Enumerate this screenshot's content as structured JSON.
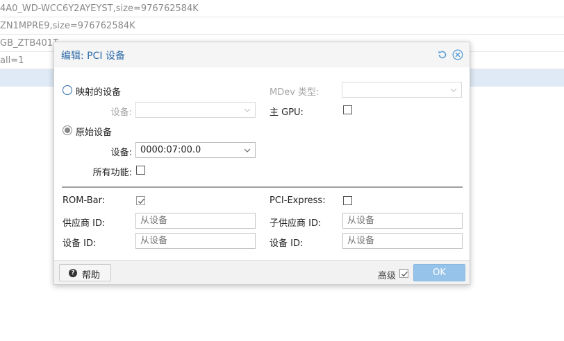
{
  "background_rows": [
    {
      "text": "4A0_WD-WCC6Y2AYEYST,size=976762584K"
    },
    {
      "text": "ZN1MPRE9,size=976762584K"
    },
    {
      "text": "GB_ZTB401T"
    },
    {
      "text": "all=1"
    },
    {
      "text": ""
    }
  ],
  "dialog": {
    "title": "编辑: PCI 设备",
    "mapped_device": {
      "label": "映射的设备",
      "device_label": "设备:",
      "device_value": ""
    },
    "raw_device": {
      "label": "原始设备",
      "device_label": "设备:",
      "device_value": "0000:07:00.0",
      "all_functions_label": "所有功能:"
    },
    "mdev_type": {
      "label": "MDev 类型:",
      "value": ""
    },
    "primary_gpu": {
      "label": "主 GPU:"
    },
    "rom_bar": {
      "label": "ROM-Bar:"
    },
    "pci_express": {
      "label": "PCI-Express:"
    },
    "vendor_id": {
      "label": "供应商 ID:",
      "placeholder": "从设备"
    },
    "sub_vendor_id": {
      "label": "子供应商 ID:",
      "placeholder": "从设备"
    },
    "device_id": {
      "label": "设备 ID:",
      "placeholder": "从设备"
    },
    "sub_device_id": {
      "label": "设备 ID:",
      "placeholder": "从设备"
    },
    "footer": {
      "help_label": "帮助",
      "advanced_label": "高级",
      "ok_label": "OK"
    }
  },
  "icons": {
    "reset": "reset-icon",
    "close": "close-icon",
    "help": "help-icon"
  },
  "colors": {
    "accent": "#2c6aa8",
    "ok_button": "#96c3e9",
    "selected_row": "#dfeaf6"
  }
}
